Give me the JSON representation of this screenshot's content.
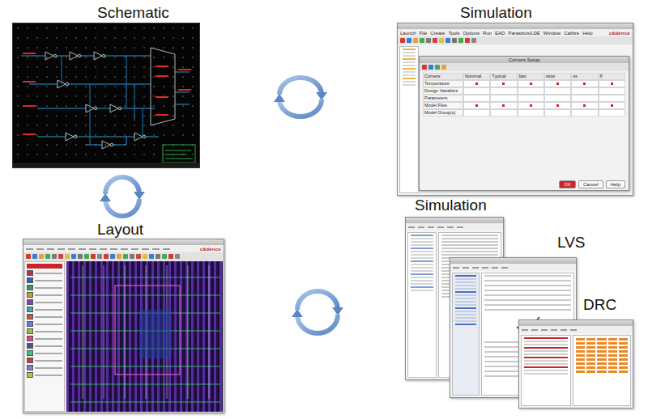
{
  "schematic": {
    "label": "Schematic"
  },
  "simulation": {
    "label": "Simulation",
    "window": {
      "brand": "cādence",
      "menus": [
        "Launch",
        "File",
        "Create",
        "Tools",
        "Options",
        "Run",
        "EAD",
        "Parasitics/LDE",
        "Window",
        "Calibre",
        "Help"
      ],
      "dialog_title": "Corners Setup",
      "columns": [
        "Corners",
        "Nominal",
        "Typical",
        "fast",
        "slow",
        "ss",
        "ff"
      ],
      "rows": [
        "Temperature",
        "Design Variables",
        "Parameters",
        "Model Files",
        "Model Group(s)"
      ],
      "buttons": [
        "OK",
        "Cancel",
        "Help"
      ]
    }
  },
  "layout": {
    "label": "Layout",
    "window": {
      "brand": "cādence"
    }
  },
  "verification": {
    "simulation_label": "Simulation",
    "lvs_label": "LVS",
    "drc_label": "DRC"
  }
}
